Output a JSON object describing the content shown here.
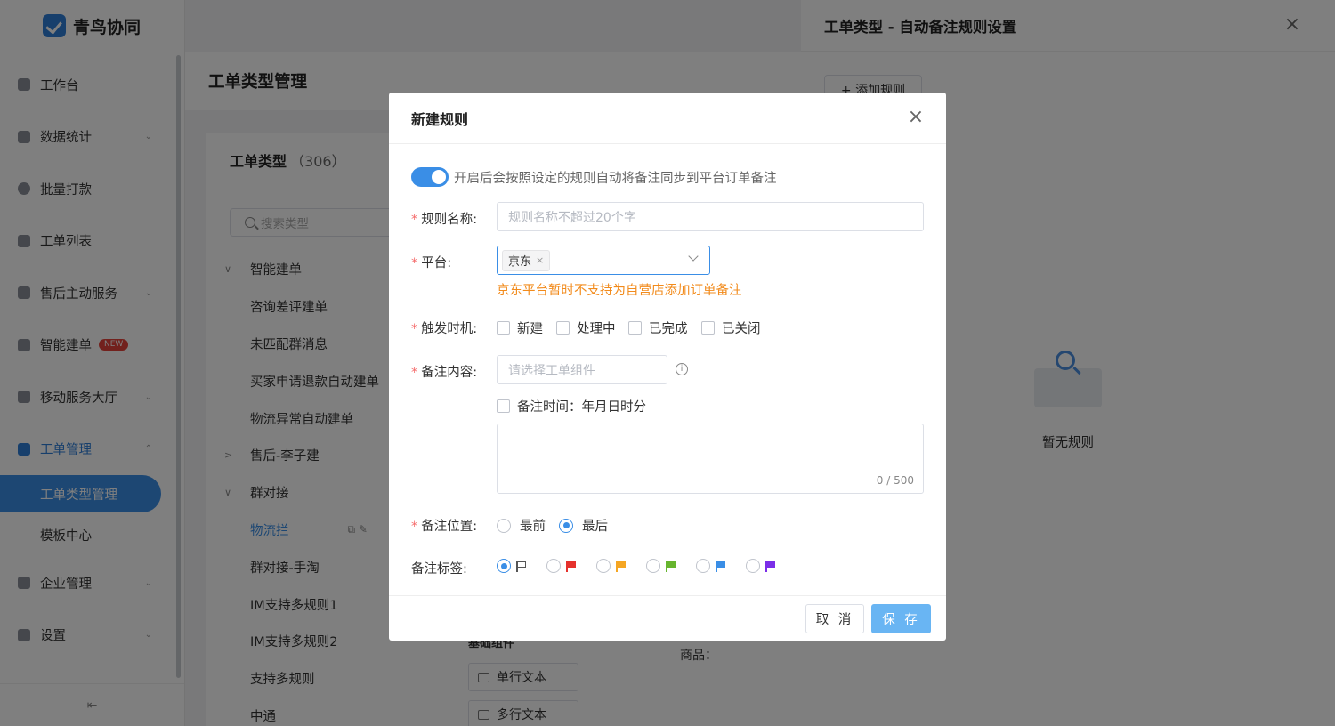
{
  "app": {
    "title": "青鸟协同"
  },
  "sidebar": {
    "items": [
      {
        "label": "工作台",
        "icon": "dashboard-icon",
        "chevron": false
      },
      {
        "label": "数据统计",
        "icon": "chart-icon",
        "chevron": true
      },
      {
        "label": "批量打款",
        "icon": "payment-icon",
        "chevron": false
      },
      {
        "label": "工单列表",
        "icon": "search-list-icon",
        "chevron": false
      },
      {
        "label": "售后主动服务",
        "icon": "message-icon",
        "chevron": true
      },
      {
        "label": "智能建单",
        "icon": "plus-box-icon",
        "chevron": false,
        "badge": "NEW"
      },
      {
        "label": "移动服务大厅",
        "icon": "bag-icon",
        "chevron": true
      },
      {
        "label": "工单管理",
        "icon": "ticket-icon",
        "chevron": true,
        "active": true
      },
      {
        "label": "企业管理",
        "icon": "building-icon",
        "chevron": true
      },
      {
        "label": "设置",
        "icon": "gear-icon",
        "chevron": true
      }
    ],
    "subitems": [
      {
        "label": "工单类型管理",
        "active": true
      },
      {
        "label": "模板中心",
        "active": false
      }
    ],
    "collapse_glyph": "⇤"
  },
  "main": {
    "header_title": "工单类型管理",
    "panel_title": "工单类型",
    "panel_count": "（306）",
    "search_placeholder": "搜索类型",
    "tree": [
      {
        "label": "智能建单",
        "level": 1,
        "caret": "∨"
      },
      {
        "label": "咨询差评建单",
        "level": 2
      },
      {
        "label": "未匹配群消息",
        "level": 2
      },
      {
        "label": "买家申请退款自动建单",
        "level": 2
      },
      {
        "label": "物流异常自动建单",
        "level": 2
      },
      {
        "label": "售后-李子建",
        "level": 1,
        "caret": ">"
      },
      {
        "label": "群对接",
        "level": 1,
        "caret": "∨"
      },
      {
        "label": "物流拦",
        "level": 2,
        "selected": true
      },
      {
        "label": "群对接-手淘",
        "level": 2
      },
      {
        "label": "IM支持多规则1",
        "level": 2
      },
      {
        "label": "IM支持多规则2",
        "level": 2
      },
      {
        "label": "支持多规则",
        "level": 2
      },
      {
        "label": "中通",
        "level": 2
      }
    ],
    "components_head": "基础组件",
    "components": [
      "单行文本",
      "多行文本"
    ],
    "goods_label": "商品："
  },
  "drawer": {
    "title": "工单类型 - 自动备注规则设置",
    "add_rule_label": "+ 添加规则",
    "empty_text": "暂无规则"
  },
  "modal": {
    "title": "新建规则",
    "toggle_on": true,
    "toggle_text": "开启后会按照设定的规则自动将备注同步到平台订单备注",
    "rule_name": {
      "label": "规则名称:",
      "placeholder": "规则名称不超过20个字",
      "value": ""
    },
    "platform": {
      "label": "平台:",
      "selected_tag": "京东",
      "warning": "京东平台暂时不支持为自营店添加订单备注"
    },
    "trigger": {
      "label": "触发时机:",
      "options": [
        "新建",
        "处理中",
        "已完成",
        "已关闭"
      ]
    },
    "content": {
      "label": "备注内容:",
      "placeholder": "请选择工单组件",
      "time_checkbox_label": "备注时间：年月日时分",
      "counter": "0 / 500"
    },
    "position": {
      "label": "备注位置:",
      "options": [
        "最前",
        "最后"
      ],
      "selected": "最后"
    },
    "tag": {
      "label": "备注标签:",
      "flags": [
        {
          "name": "no-flag",
          "color": "none",
          "selected": true
        },
        {
          "name": "red-flag",
          "color": "#e5322d",
          "selected": false
        },
        {
          "name": "orange-flag",
          "color": "#f5a623",
          "selected": false
        },
        {
          "name": "green-flag",
          "color": "#67b52e",
          "selected": false
        },
        {
          "name": "blue-flag",
          "color": "#3a8ee6",
          "selected": false
        },
        {
          "name": "purple-flag",
          "color": "#7b2ee8",
          "selected": false
        }
      ]
    },
    "buttons": {
      "cancel": "取 消",
      "save": "保 存"
    }
  },
  "colors": {
    "accent": "#3a8ee6",
    "save_button": "#69b5f3",
    "warning": "#f28b1c",
    "required": "#f56c6c"
  }
}
